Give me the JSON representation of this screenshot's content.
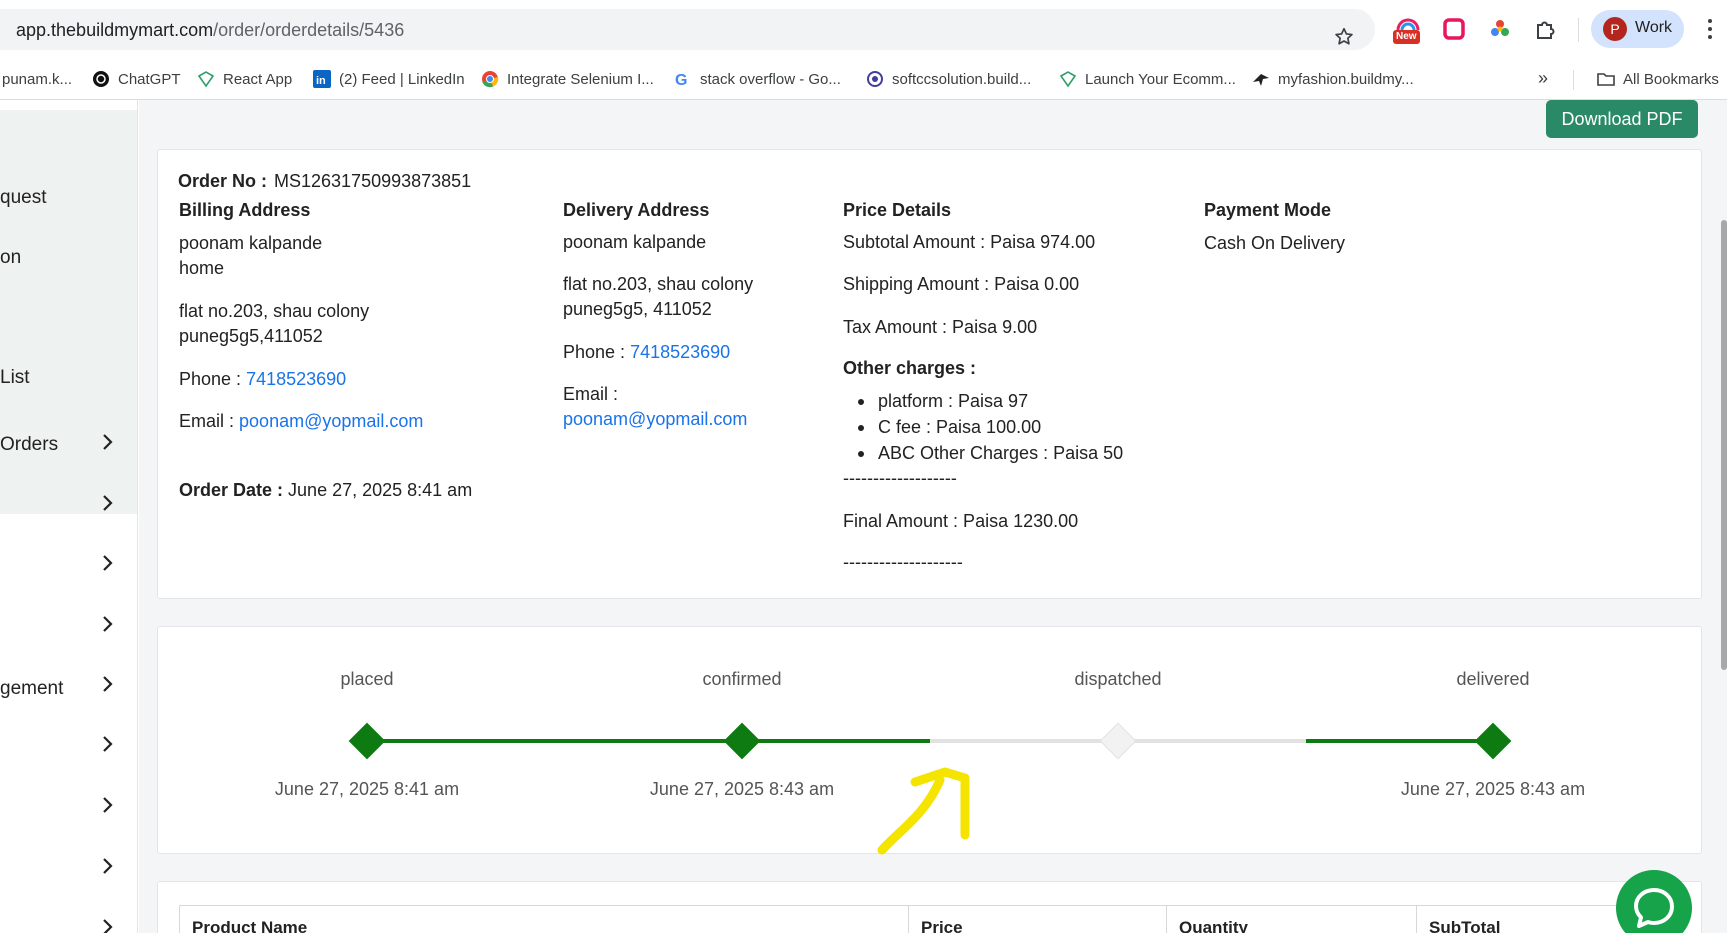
{
  "browser": {
    "url_domain": "app.thebuildmymart.com",
    "url_path": "/order/orderdetails/5436",
    "ext_badge": "New",
    "profile_initial": "P",
    "profile_name": "Work",
    "bookmarks": [
      {
        "label": "punam.k...",
        "icon": "bookmark-icon"
      },
      {
        "label": "ChatGPT",
        "icon": "chatgpt-icon"
      },
      {
        "label": "React App",
        "icon": "react-icon"
      },
      {
        "label": "(2) Feed | LinkedIn",
        "icon": "linkedin-icon"
      },
      {
        "label": "Integrate Selenium I...",
        "icon": "chrome-icon"
      },
      {
        "label": "stack overflow - Go...",
        "icon": "google-icon"
      },
      {
        "label": "softccsolution.build...",
        "icon": "site-icon"
      },
      {
        "label": "Launch Your Ecomm...",
        "icon": "react-icon"
      },
      {
        "label": "myfashion.buildmy...",
        "icon": "site-icon"
      }
    ],
    "all_bookmarks": "All Bookmarks"
  },
  "sidebar": {
    "items": [
      "quest",
      "on",
      " List",
      "Orders",
      "gement"
    ]
  },
  "actions": {
    "download_pdf": "Download PDF"
  },
  "order": {
    "order_no_label": "Order No :",
    "order_no": "MS12631750993873851",
    "billing": {
      "heading": "Billing Address",
      "name": "poonam kalpande",
      "type": "home",
      "line1": "flat no.203, shau colony",
      "line2": "puneg5g5,411052",
      "phone_label": "Phone :",
      "phone": "7418523690",
      "email_label": "Email :",
      "email": "poonam@yopmail.com"
    },
    "order_date_label": "Order Date :",
    "order_date": "June 27, 2025 8:41 am",
    "delivery": {
      "heading": "Delivery Address",
      "name": "poonam kalpande",
      "line1": "flat no.203, shau colony",
      "line2": "puneg5g5, 411052",
      "phone_label": "Phone :",
      "phone": "7418523690",
      "email_label": "Email :",
      "email": "poonam@yopmail.com"
    },
    "price": {
      "heading": "Price Details",
      "subtotal": "Subtotal Amount : Paisa 974.00",
      "shipping": "Shipping Amount : Paisa 0.00",
      "tax": "Tax Amount : Paisa  9.00",
      "other_heading": "Other charges :",
      "other_items": [
        "platform :  Paisa  97",
        "C fee :  Paisa  100.00",
        "ABC Other Charges :  Paisa  50"
      ],
      "divider1": "-------------------",
      "final": "Final Amount : Paisa  1230.00",
      "divider2": "--------------------"
    },
    "payment": {
      "heading": "Payment Mode",
      "mode": "Cash On Delivery"
    }
  },
  "progress": {
    "stages": [
      {
        "label": "placed",
        "date": "June 27, 2025 8:41 am",
        "done": true
      },
      {
        "label": "confirmed",
        "date": "June 27, 2025 8:43 am",
        "done": true
      },
      {
        "label": "dispatched",
        "date": "",
        "done": false
      },
      {
        "label": "delivered",
        "date": "June 27, 2025 8:43 am",
        "done": true
      }
    ],
    "done_color": "#0e7a12",
    "pending_color": "#e2e2e2"
  },
  "table": {
    "headers": [
      "Product Name",
      "Price",
      "Quantity",
      "SubTotal"
    ]
  },
  "colors": {
    "accent": "#2a8a68",
    "link": "#1a73e8",
    "chat": "#16a34a",
    "annotation": "#f5e300"
  }
}
